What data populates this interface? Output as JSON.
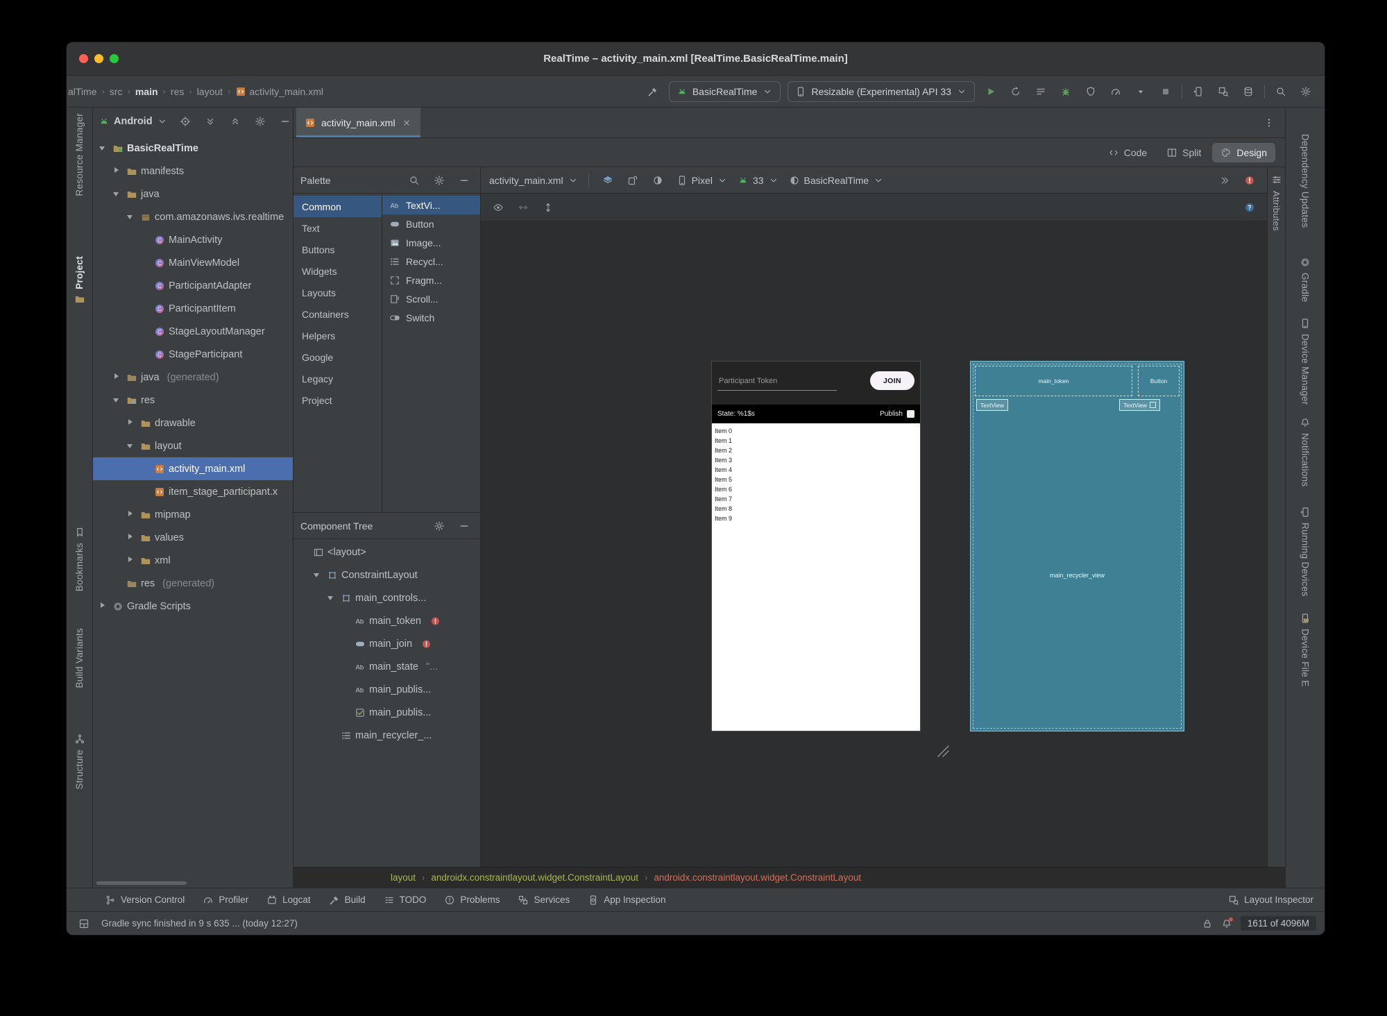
{
  "titlebar": {
    "title": "RealTime – activity_main.xml [RealTime.BasicRealTime.main]"
  },
  "navbar": {
    "breadcrumbs": [
      {
        "label": "alTime"
      },
      {
        "label": "src"
      },
      {
        "label": "main",
        "bold": true
      },
      {
        "label": "res"
      },
      {
        "label": "layout"
      },
      {
        "label": "activity_main.xml",
        "icon": "xml-file"
      }
    ],
    "run_config": "BasicRealTime",
    "device_selector": "Resizable (Experimental) API 33",
    "actions": [
      "run",
      "rerun",
      "build-list",
      "debug",
      "coverage",
      "profiler",
      "more-run-options",
      "stop"
    ],
    "device_tools": [
      "device-mirror",
      "layout-inspector-tool",
      "database-inspector"
    ],
    "corner_actions": [
      "search-everywhere",
      "settings"
    ]
  },
  "left_strip": {
    "items": [
      {
        "label": "Resource Manager"
      },
      {
        "label": "Project",
        "icon": "folder",
        "icon_pos": "after",
        "active": true
      },
      {
        "label": "Bookmarks",
        "icon": "bookmark"
      },
      {
        "label": "Build Variants"
      },
      {
        "label": "Structure",
        "icon": "structure"
      }
    ]
  },
  "right_strip": {
    "items": [
      {
        "label": "Dependency Updates"
      },
      {
        "label": "Gradle",
        "icon": "gradle"
      },
      {
        "label": "Device Manager",
        "icon": "device"
      },
      {
        "label": "Notifications",
        "icon": "bell"
      },
      {
        "label": "Running Devices",
        "icon": "device-mirror"
      },
      {
        "label": "Device File E",
        "icon": "device-folder"
      }
    ]
  },
  "attributes_tab": {
    "label": "Attributes",
    "icon": "sliders"
  },
  "project_panel": {
    "mode": "Android",
    "header_icons": [
      "locate-file",
      "expand-all",
      "collapse-all",
      "settings",
      "hide"
    ],
    "tree": [
      {
        "depth": 0,
        "chevron": "open",
        "icon": "android-module",
        "label": "BasicRealTime",
        "bold": true
      },
      {
        "depth": 1,
        "chevron": "closed",
        "icon": "folder",
        "label": "manifests"
      },
      {
        "depth": 1,
        "chevron": "open",
        "icon": "folder",
        "label": "java"
      },
      {
        "depth": 2,
        "chevron": "open",
        "icon": "package",
        "label": "com.amazonaws.ivs.realtime"
      },
      {
        "depth": 3,
        "icon": "kotlin-class",
        "label": "MainActivity"
      },
      {
        "depth": 3,
        "icon": "kotlin-class",
        "label": "MainViewModel"
      },
      {
        "depth": 3,
        "icon": "kotlin-class",
        "label": "ParticipantAdapter"
      },
      {
        "depth": 3,
        "icon": "kotlin-class",
        "label": "ParticipantItem"
      },
      {
        "depth": 3,
        "icon": "kotlin-class",
        "label": "StageLayoutManager"
      },
      {
        "depth": 3,
        "icon": "kotlin-class",
        "label": "StageParticipant"
      },
      {
        "depth": 1,
        "chevron": "closed",
        "icon": "folder-generated",
        "label": "java",
        "suffix": "(generated)"
      },
      {
        "depth": 1,
        "chevron": "open",
        "icon": "res-folder",
        "label": "res"
      },
      {
        "depth": 2,
        "chevron": "closed",
        "icon": "folder",
        "label": "drawable"
      },
      {
        "depth": 2,
        "chevron": "open",
        "icon": "folder",
        "label": "layout"
      },
      {
        "depth": 3,
        "icon": "xml-file",
        "label": "activity_main.xml",
        "selected": true
      },
      {
        "depth": 3,
        "icon": "xml-file",
        "label": "item_stage_participant.x"
      },
      {
        "depth": 2,
        "chevron": "closed",
        "icon": "folder",
        "label": "mipmap"
      },
      {
        "depth": 2,
        "chevron": "closed",
        "icon": "folder",
        "label": "values"
      },
      {
        "depth": 2,
        "chevron": "closed",
        "icon": "folder",
        "label": "xml"
      },
      {
        "depth": 1,
        "icon": "folder-generated",
        "label": "res",
        "suffix": "(generated)"
      },
      {
        "depth": 0,
        "chevron": "closed",
        "icon": "gradle",
        "label": "Gradle Scripts"
      }
    ]
  },
  "editor": {
    "tab": "activity_main.xml",
    "modes": [
      {
        "label": "Code",
        "icon": "code-mode"
      },
      {
        "label": "Split",
        "icon": "split-mode"
      },
      {
        "label": "Design",
        "icon": "design-mode",
        "active": true
      }
    ]
  },
  "palette": {
    "title": "Palette",
    "header_icons": [
      "search",
      "settings",
      "hide"
    ],
    "categories": [
      "Common",
      "Text",
      "Buttons",
      "Widgets",
      "Layouts",
      "Containers",
      "Helpers",
      "Google",
      "Legacy",
      "Project"
    ],
    "selected_category": "Common",
    "items": [
      {
        "label": "TextVi...",
        "icon": "text-view",
        "selected": true
      },
      {
        "label": "Button",
        "icon": "button-widget"
      },
      {
        "label": "Image...",
        "icon": "image-view"
      },
      {
        "label": "Recycl...",
        "icon": "recycler-view"
      },
      {
        "label": "Fragm...",
        "icon": "fragment"
      },
      {
        "label": "Scroll...",
        "icon": "scroll-view"
      },
      {
        "label": "Switch",
        "icon": "switch-widget"
      }
    ]
  },
  "component_tree": {
    "title": "Component Tree",
    "header_icons": [
      "settings",
      "hide"
    ],
    "items": [
      {
        "depth": 0,
        "icon": "layout-tag",
        "label": "<layout>"
      },
      {
        "depth": 1,
        "chevron": "open",
        "icon": "constraint-layout",
        "label": "ConstraintLayout"
      },
      {
        "depth": 2,
        "chevron": "open",
        "icon": "constraint-layout",
        "label": "main_controls..."
      },
      {
        "depth": 3,
        "icon": "text-view",
        "label": "main_token",
        "error": true
      },
      {
        "depth": 3,
        "icon": "button-widget",
        "label": "main_join",
        "error": true
      },
      {
        "depth": 3,
        "icon": "text-view",
        "label": "main_state",
        "suffix": "\"..."
      },
      {
        "depth": 3,
        "icon": "text-view",
        "label": "main_publis..."
      },
      {
        "depth": 3,
        "icon": "checkbox-widget",
        "label": "main_publis..."
      },
      {
        "depth": 2,
        "icon": "recycler-view",
        "label": "main_recycler_..."
      }
    ]
  },
  "design_toolbar": {
    "file": "activity_main.xml",
    "surface_icons": [
      "design-blueprint",
      "orientation",
      "night-mode"
    ],
    "device": "Pixel",
    "api": "33",
    "theme": "BasicRealTime",
    "right_icons": [
      "overflow",
      "render-errors"
    ],
    "row2_left": [
      "view-options",
      "pan-horizontal",
      "pan-vertical"
    ],
    "row2_right": [
      "help"
    ]
  },
  "design_preview": {
    "token_hint": "Participant Token",
    "join_label": "JOIN",
    "state_text": "State: %1$s",
    "publish_label": "Publish",
    "list_items": [
      "Item 0",
      "Item 1",
      "Item 2",
      "Item 3",
      "Item 4",
      "Item 5",
      "Item 6",
      "Item 7",
      "Item 8",
      "Item 9"
    ]
  },
  "blueprint": {
    "token": "main_token",
    "button": "Button",
    "textview_left": "TextView",
    "textview_right": "TextView",
    "recycler": "main_recycler_view"
  },
  "bottom_breadcrumb": {
    "items": [
      {
        "label": "layout",
        "color": "#A9B652"
      },
      {
        "label": "androidx.constraintlayout.widget.ConstraintLayout",
        "color": "#A9B652"
      },
      {
        "label": "androidx.constraintlayout.widget.ConstraintLayout",
        "color": "#D2705B"
      }
    ]
  },
  "bottom_toolbar": {
    "left": [
      {
        "label": "Version Control",
        "icon": "branch"
      },
      {
        "label": "Profiler",
        "icon": "profiler"
      },
      {
        "label": "Logcat",
        "icon": "logcat"
      },
      {
        "label": "Build",
        "icon": "build-hammer"
      },
      {
        "label": "TODO",
        "icon": "todo"
      },
      {
        "label": "Problems",
        "icon": "problems"
      },
      {
        "label": "Services",
        "icon": "services"
      },
      {
        "label": "App Inspection",
        "icon": "app-inspection"
      }
    ],
    "right": [
      {
        "label": "Layout Inspector",
        "icon": "layout-inspector-tool"
      }
    ]
  },
  "status_bar": {
    "message": "Gradle sync finished in 9 s 635 ... (today 12:27)",
    "memory": "1611 of 4096M"
  },
  "colors": {
    "selection_blue": "#4B6EAF",
    "list_selection": "#365880",
    "error_red": "#C7544F",
    "android_green": "#4EB05E",
    "blueprint_teal": "#3F8095"
  }
}
